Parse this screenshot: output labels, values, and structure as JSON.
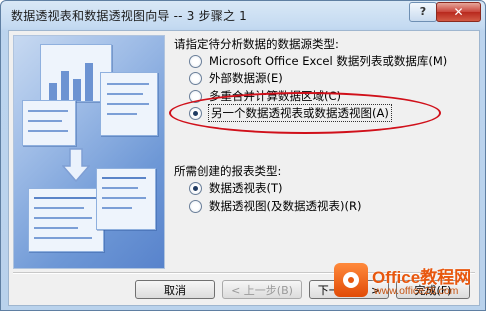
{
  "window": {
    "title": "数据透视表和数据透视图向导 -- 3 步骤之 1",
    "help_label": "?",
    "close_label": "✕"
  },
  "source_group": {
    "label": "请指定待分析数据的数据源类型:",
    "options": [
      {
        "label": "Microsoft Office Excel 数据列表或数据库(M)",
        "checked": false
      },
      {
        "label": "外部数据源(E)",
        "checked": false
      },
      {
        "label": "多重合并计算数据区域(C)",
        "checked": false
      },
      {
        "label": "另一个数据透视表或数据透视图(A)",
        "checked": true
      }
    ]
  },
  "report_group": {
    "label": "所需创建的报表类型:",
    "options": [
      {
        "label": "数据透视表(T)",
        "checked": true
      },
      {
        "label": "数据透视图(及数据透视表)(R)",
        "checked": false
      }
    ]
  },
  "buttons": {
    "cancel": "取消",
    "back": "< 上一步(B)",
    "next": "下一步(N) >",
    "finish": "完成(F)"
  },
  "watermark": {
    "brand": "Office教程网",
    "url": "www.office26.com"
  },
  "colors": {
    "annotation": "#d0101a",
    "brand": "#e8570e"
  }
}
